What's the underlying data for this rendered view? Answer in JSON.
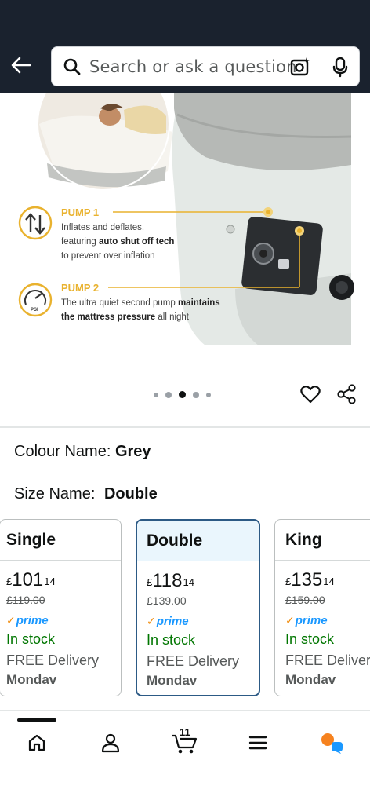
{
  "header": {
    "search_placeholder": "Search or ask a question"
  },
  "product_image": {
    "pump1_title": "PUMP 1",
    "pump1_line1": "Inflates and deflates,",
    "pump1_line2_pre": "featuring ",
    "pump1_line2_bold": "auto shut off tech",
    "pump1_line3": "to prevent over inflation",
    "pump2_title": "PUMP 2",
    "pump2_line1_pre": "The ultra quiet second pump ",
    "pump2_line1_bold": "maintains",
    "pump2_line2_bold": "the mattress pressure",
    "pump2_line2_post": " all night",
    "psi_label": "PSI",
    "carousel": {
      "count": 5,
      "active_index": 2
    }
  },
  "colour": {
    "label": "Colour Name:",
    "value": "Grey"
  },
  "size": {
    "label": "Size Name:",
    "value": "Double"
  },
  "size_options": [
    {
      "name": "Single",
      "currency": "£",
      "whole": "101",
      "fraction": "14",
      "was": "£119.00",
      "prime": "prime",
      "stock": "In stock",
      "delivery": "FREE Delivery",
      "date": "Mondav",
      "selected": false
    },
    {
      "name": "Double",
      "currency": "£",
      "whole": "118",
      "fraction": "14",
      "was": "£139.00",
      "prime": "prime",
      "stock": "In stock",
      "delivery": "FREE Delivery",
      "date": "Mondav",
      "selected": true
    },
    {
      "name": "King",
      "currency": "£",
      "whole": "135",
      "fraction": "14",
      "was": "£159.00",
      "prime": "prime",
      "stock": "In stock",
      "delivery": "FREE Delivery",
      "date": "Mondav",
      "selected": false
    }
  ],
  "nav": {
    "cart_count": "11"
  },
  "colors": {
    "topbar": "#1a222e",
    "selected_border": "#2c5a85",
    "in_stock": "#007600",
    "prime_blue": "#1a98ff",
    "accent": "#e9b22e"
  }
}
